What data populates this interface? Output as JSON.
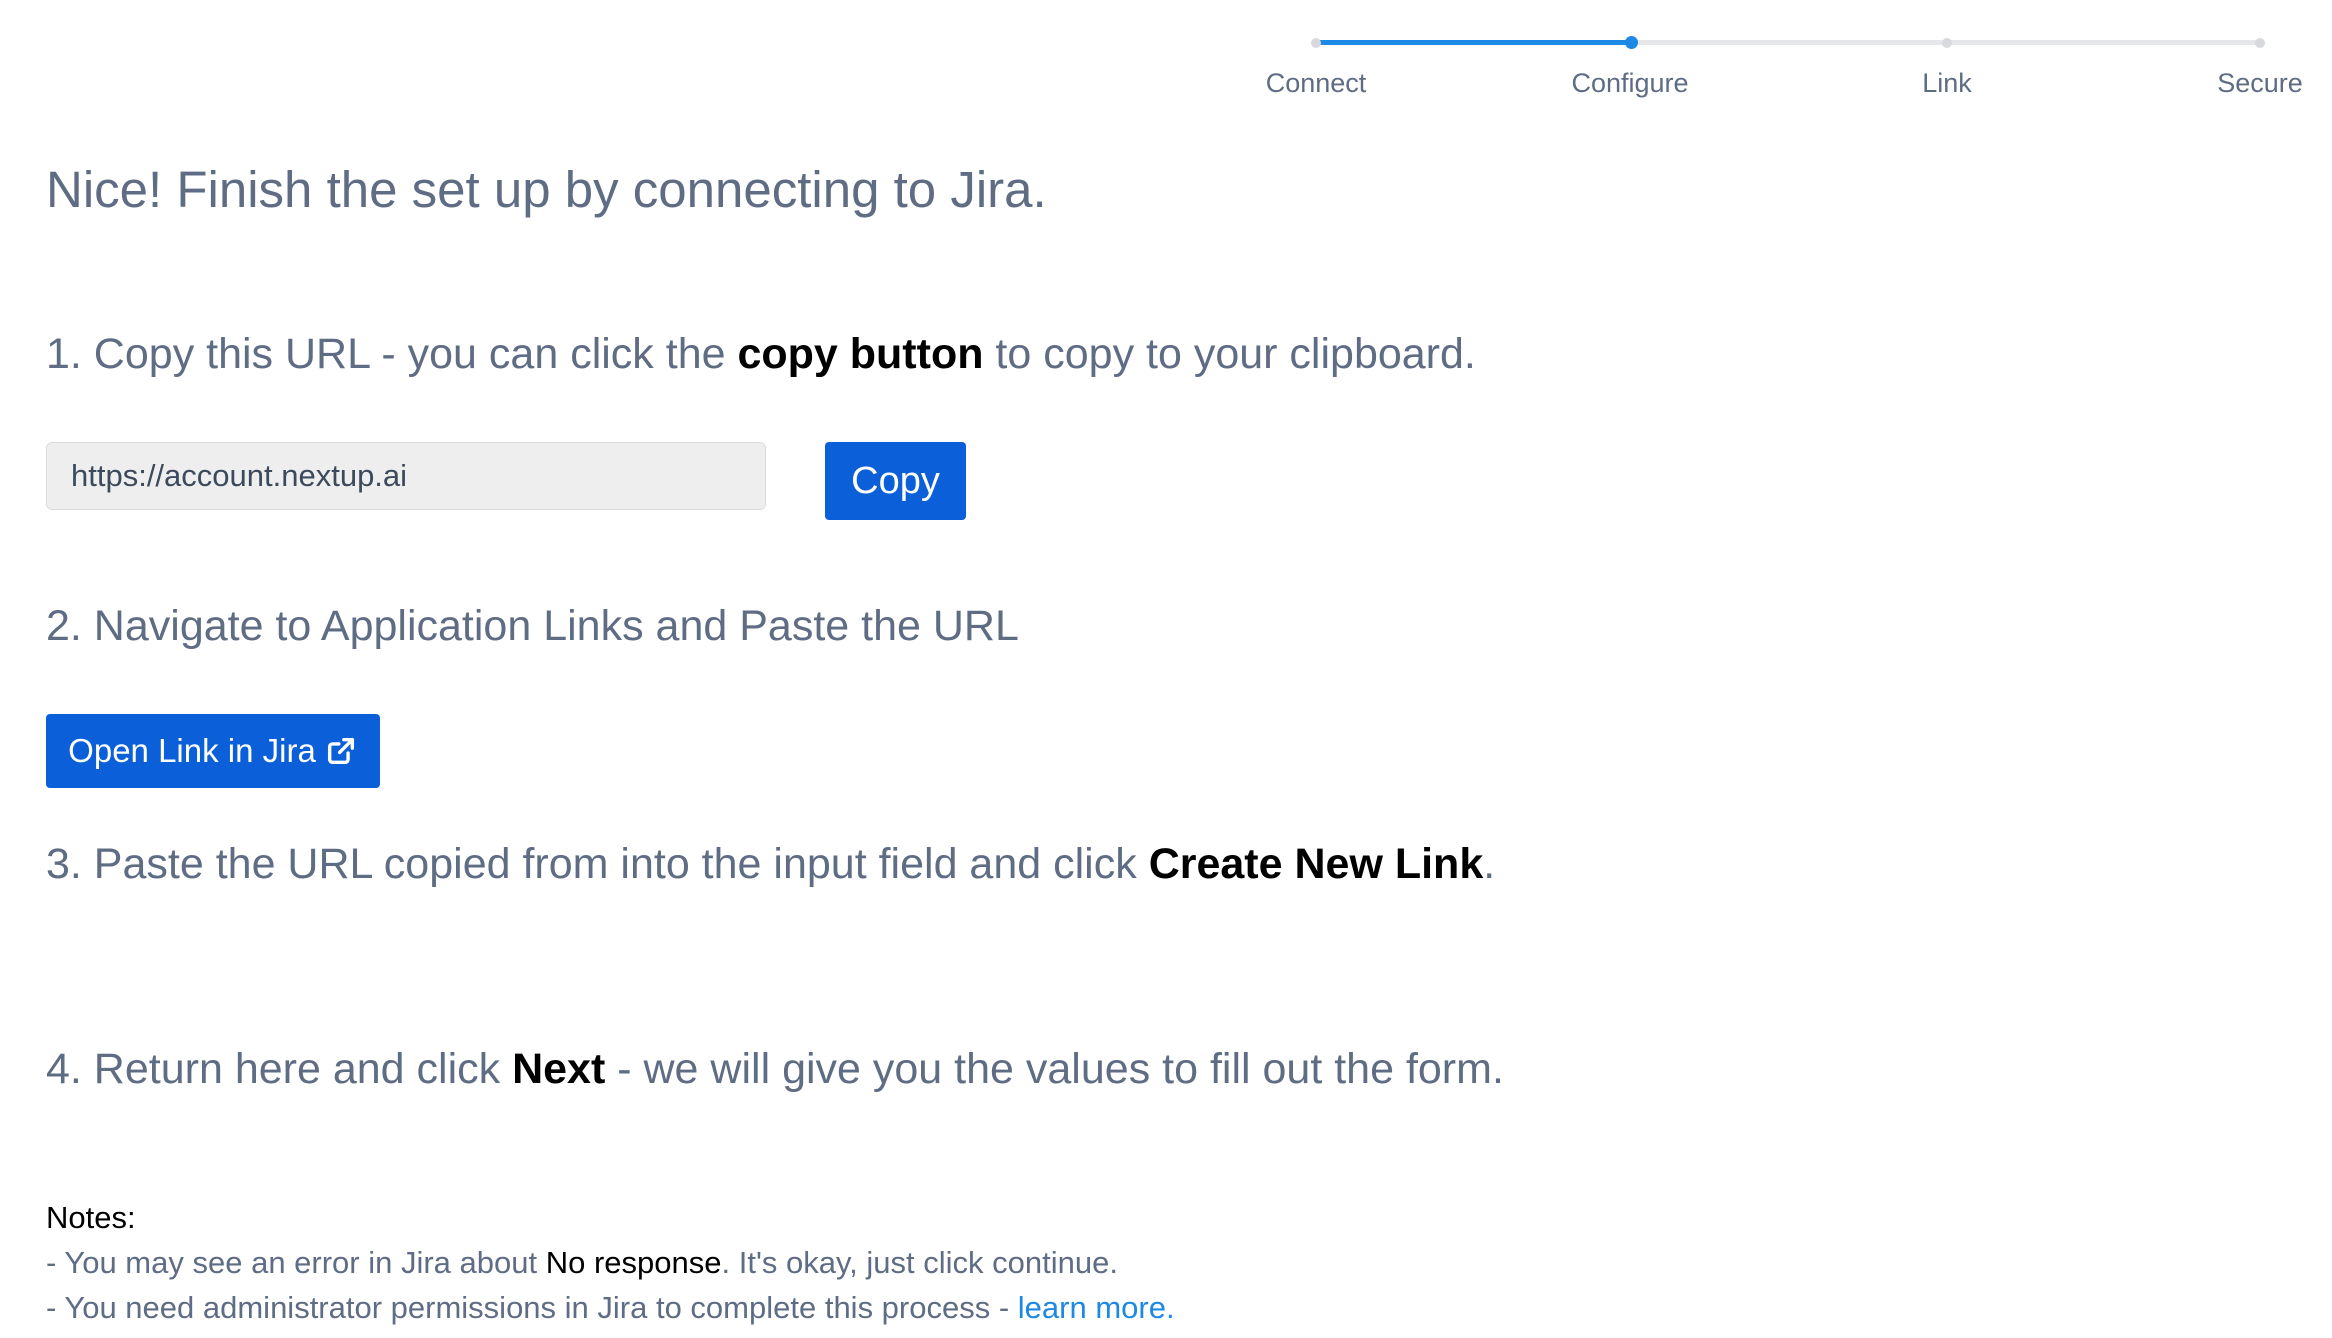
{
  "stepper": {
    "steps": [
      {
        "label": "Connect",
        "state": "complete"
      },
      {
        "label": "Configure",
        "state": "current"
      },
      {
        "label": "Link",
        "state": "upcoming"
      },
      {
        "label": "Secure",
        "state": "upcoming"
      }
    ],
    "progress_fraction": 0.333,
    "active_color": "#1e88e5",
    "inactive_color": "#e6e7ea"
  },
  "heading": "Nice! Finish the set up by connecting to Jira.",
  "step1": {
    "prefix": "1. Copy this URL - you can click the ",
    "bold": "copy button",
    "suffix": " to copy to your clipboard.",
    "url_value": "https://account.nextup.ai",
    "copy_label": "Copy"
  },
  "step2": {
    "text": "2. Navigate to Application Links and Paste the URL",
    "open_label": "Open Link in Jira",
    "open_icon": "external-link-icon"
  },
  "step3": {
    "prefix": "3. Paste the URL copied from into the input field and click ",
    "bold": "Create New Link",
    "suffix": "."
  },
  "step4": {
    "prefix": "4. Return here and click ",
    "bold": "Next",
    "suffix": " - we will give you the values to fill out the form."
  },
  "notes": {
    "title": "Notes:",
    "line1_prefix": "- You may see an error in Jira about ",
    "line1_bold": "No response",
    "line1_suffix": ". It's okay, just click continue.",
    "line2_prefix": "- You need administrator permissions in Jira to complete this process - ",
    "line2_link": "learn more."
  },
  "colors": {
    "primary_button": "#0b5fd8",
    "link": "#1e88e5",
    "body_text": "#5e6c84"
  }
}
